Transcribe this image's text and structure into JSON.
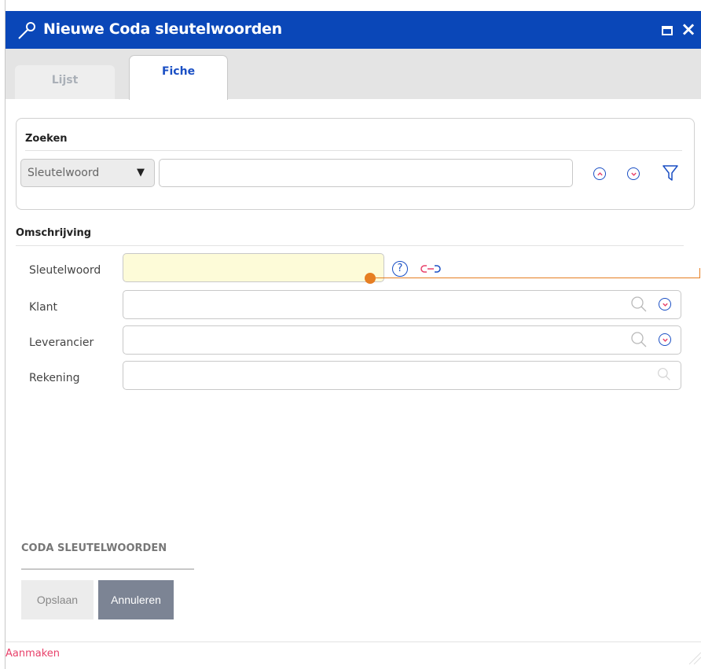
{
  "window": {
    "title": "Nieuwe Coda sleutelwoorden",
    "title_bar_color": "#0a47b8",
    "maximize_icon": "maximize-icon",
    "close_label": "×"
  },
  "tabs": [
    {
      "label": "Lijst",
      "active": false
    },
    {
      "label": "Fiche",
      "active": true
    }
  ],
  "search": {
    "title": "Zoeken",
    "field_select": "Sleutelwoord",
    "field_select_caret": "▼",
    "query": "",
    "icons": [
      "collapse-up-icon",
      "expand-down-icon",
      "filter-icon"
    ]
  },
  "form": {
    "section_title": "Omschrijving",
    "fields": [
      {
        "label": "Sleutelwoord",
        "value": "",
        "required": true
      },
      {
        "label": "Klant",
        "value": ""
      },
      {
        "label": "Leverancier",
        "value": ""
      },
      {
        "label": "Rekening",
        "value": ""
      }
    ],
    "help_label": "?"
  },
  "footer": {
    "section_title": "CODA SLEUTELWOORDEN",
    "save_label": "Opslaan",
    "cancel_label": "Annuleren",
    "mode_label": "Aanmaken"
  },
  "colors": {
    "accent": "#1a4fc4",
    "required_field": "#fdfbd8",
    "annotation": "#e67e22",
    "mode_text": "#e8416a"
  }
}
